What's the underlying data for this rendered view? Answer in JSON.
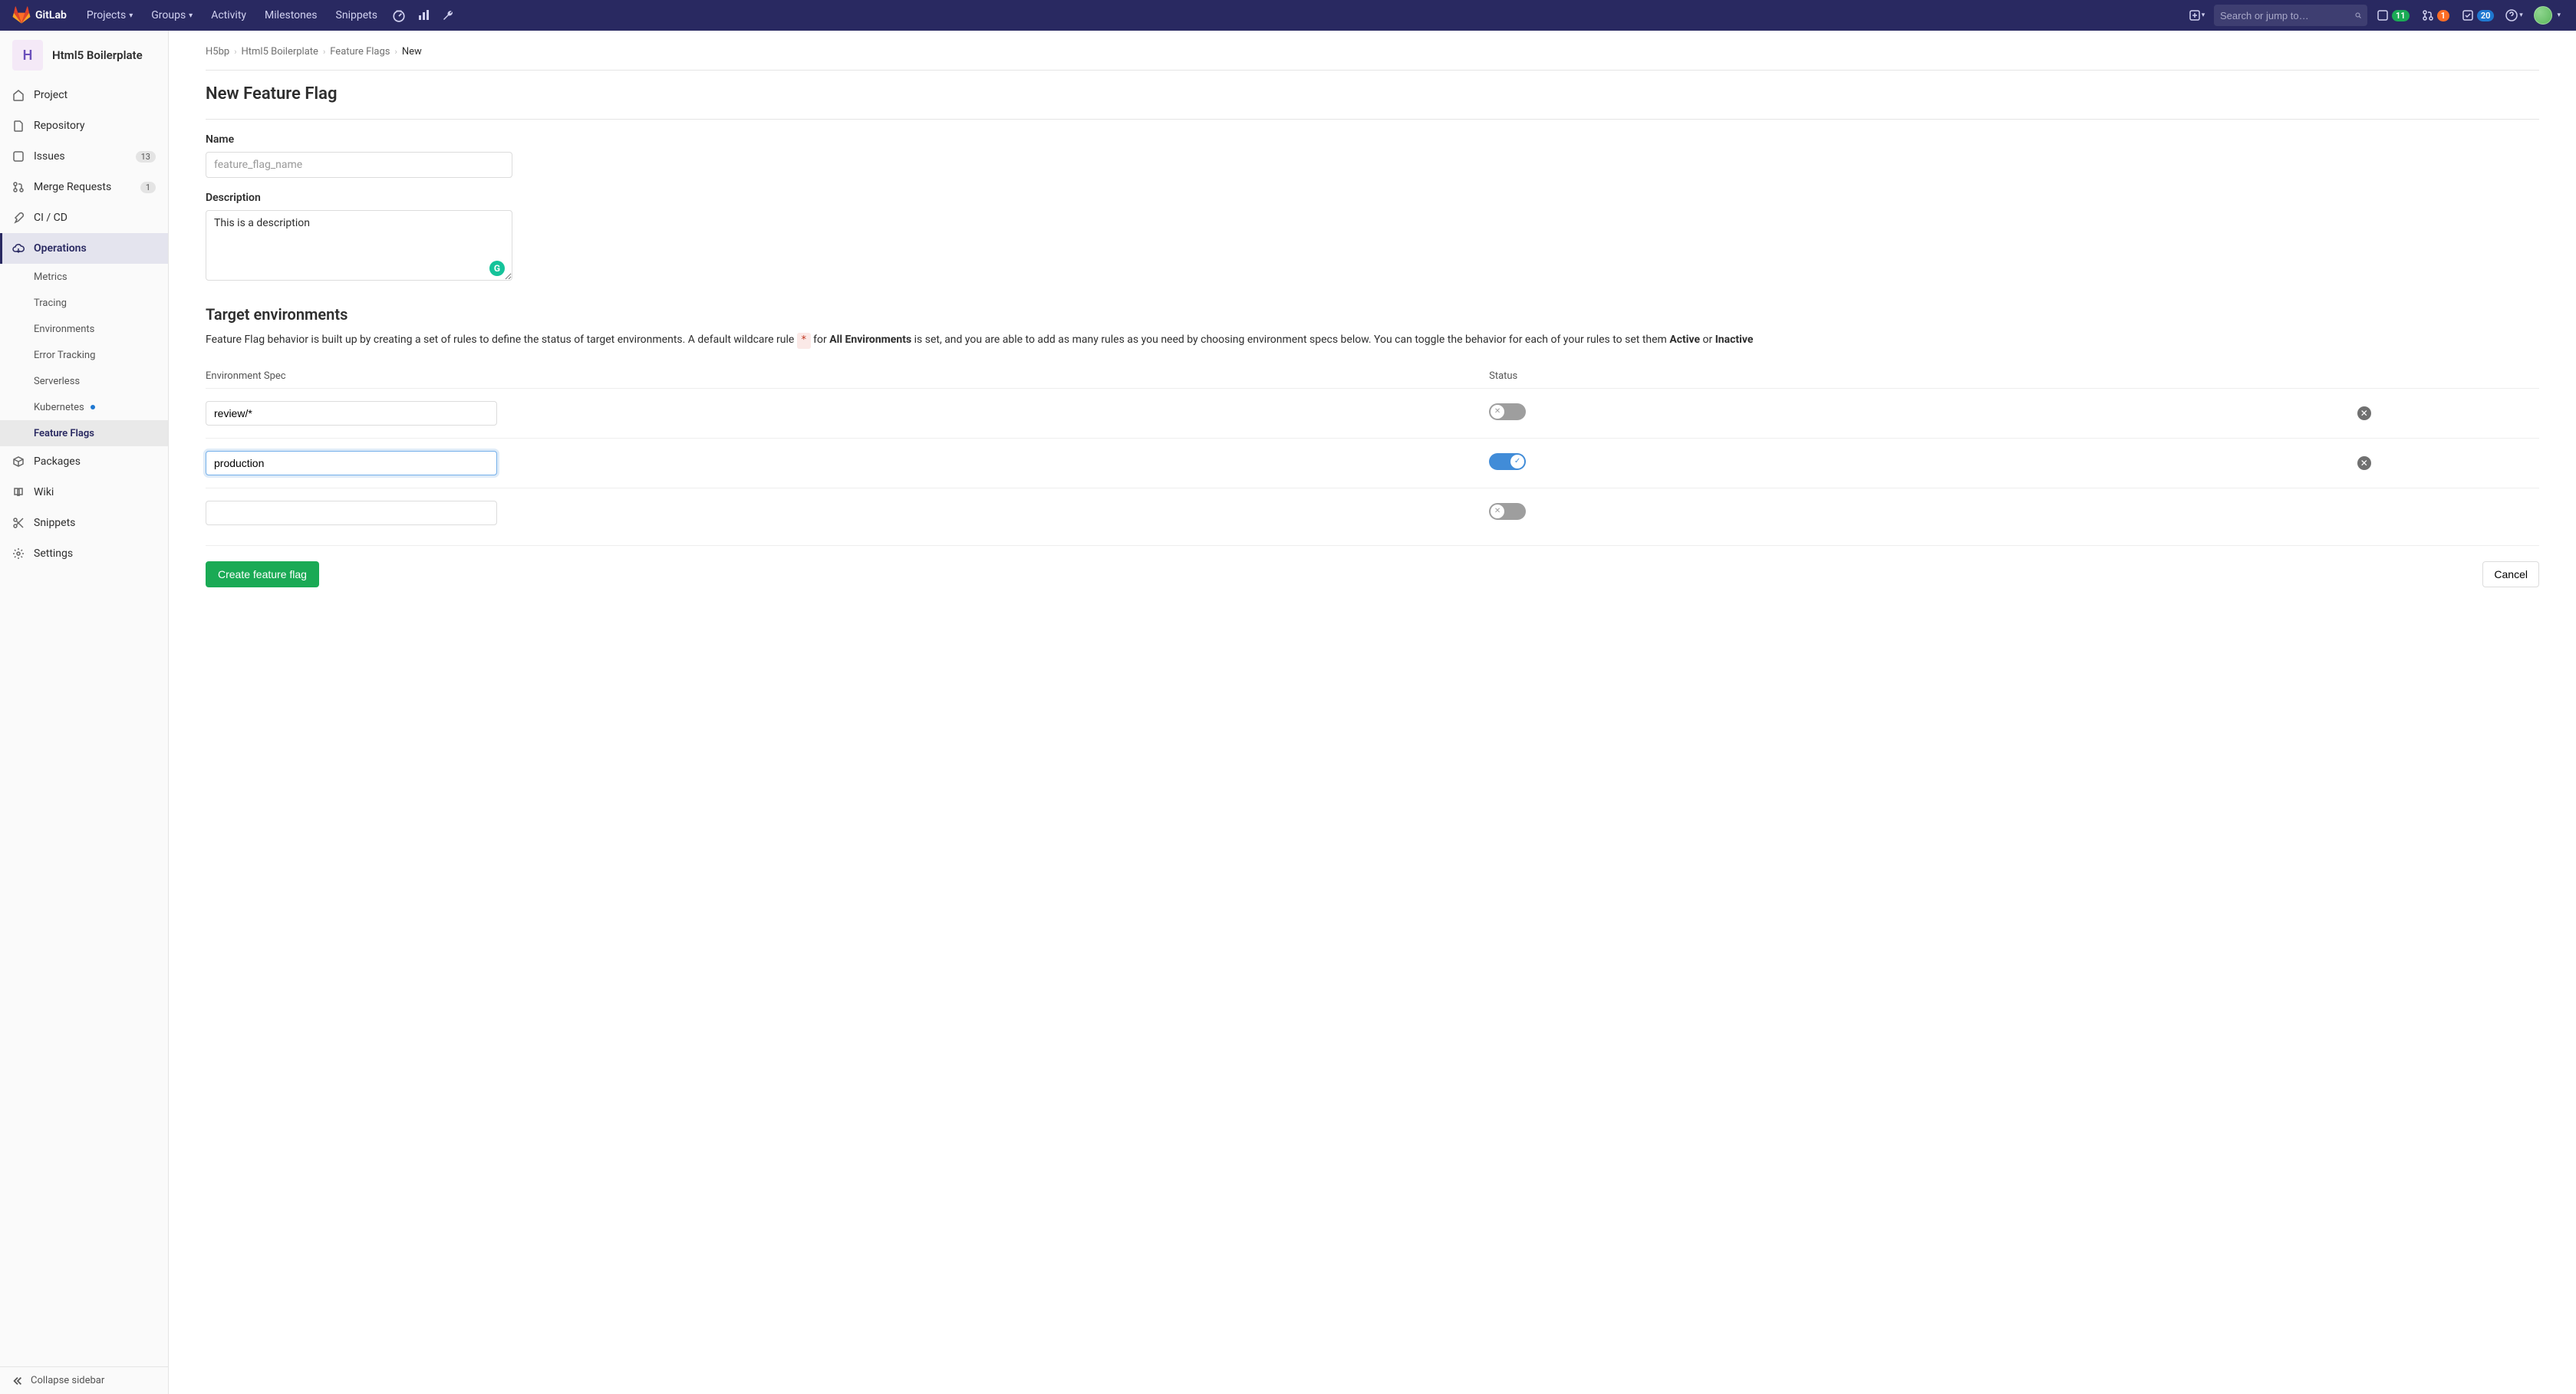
{
  "header": {
    "brand": "GitLab",
    "nav": [
      "Projects",
      "Groups",
      "Activity",
      "Milestones",
      "Snippets"
    ],
    "search_placeholder": "Search or jump to…",
    "issues_count": "11",
    "mr_count": "1",
    "todos_count": "20"
  },
  "sidebar": {
    "project_letter": "H",
    "project_name": "Html5 Boilerplate",
    "items": [
      {
        "label": "Project"
      },
      {
        "label": "Repository"
      },
      {
        "label": "Issues",
        "count": "13"
      },
      {
        "label": "Merge Requests",
        "count": "1"
      },
      {
        "label": "CI / CD"
      },
      {
        "label": "Operations"
      },
      {
        "label": "Packages"
      },
      {
        "label": "Wiki"
      },
      {
        "label": "Snippets"
      },
      {
        "label": "Settings"
      }
    ],
    "operations_sub": [
      "Metrics",
      "Tracing",
      "Environments",
      "Error Tracking",
      "Serverless",
      "Kubernetes",
      "Feature Flags"
    ],
    "collapse": "Collapse sidebar"
  },
  "breadcrumb": [
    "H5bp",
    "Html5 Boilerplate",
    "Feature Flags",
    "New"
  ],
  "page": {
    "title": "New Feature Flag",
    "name_label": "Name",
    "name_placeholder": "feature_flag_name",
    "desc_label": "Description",
    "desc_value": "This is a description",
    "target_title": "Target environments",
    "target_desc_1": "Feature Flag behavior is built up by creating a set of rules to define the status of target environments. A default wildcare rule ",
    "target_desc_wild": "*",
    "target_desc_2": " for ",
    "target_desc_all": "All Environments",
    "target_desc_3": " is set, and you are able to add as many rules as you need by choosing environment specs below. You can toggle the behavior for each of your rules to set them ",
    "target_desc_active": "Active",
    "target_desc_4": " or ",
    "target_desc_inactive": "Inactive",
    "col_spec": "Environment Spec",
    "col_status": "Status",
    "rows": [
      {
        "value": "review/*",
        "on": false
      },
      {
        "value": "production",
        "on": true,
        "focused": true
      },
      {
        "value": "",
        "on": false,
        "no_delete": true
      }
    ],
    "submit": "Create feature flag",
    "cancel": "Cancel"
  }
}
